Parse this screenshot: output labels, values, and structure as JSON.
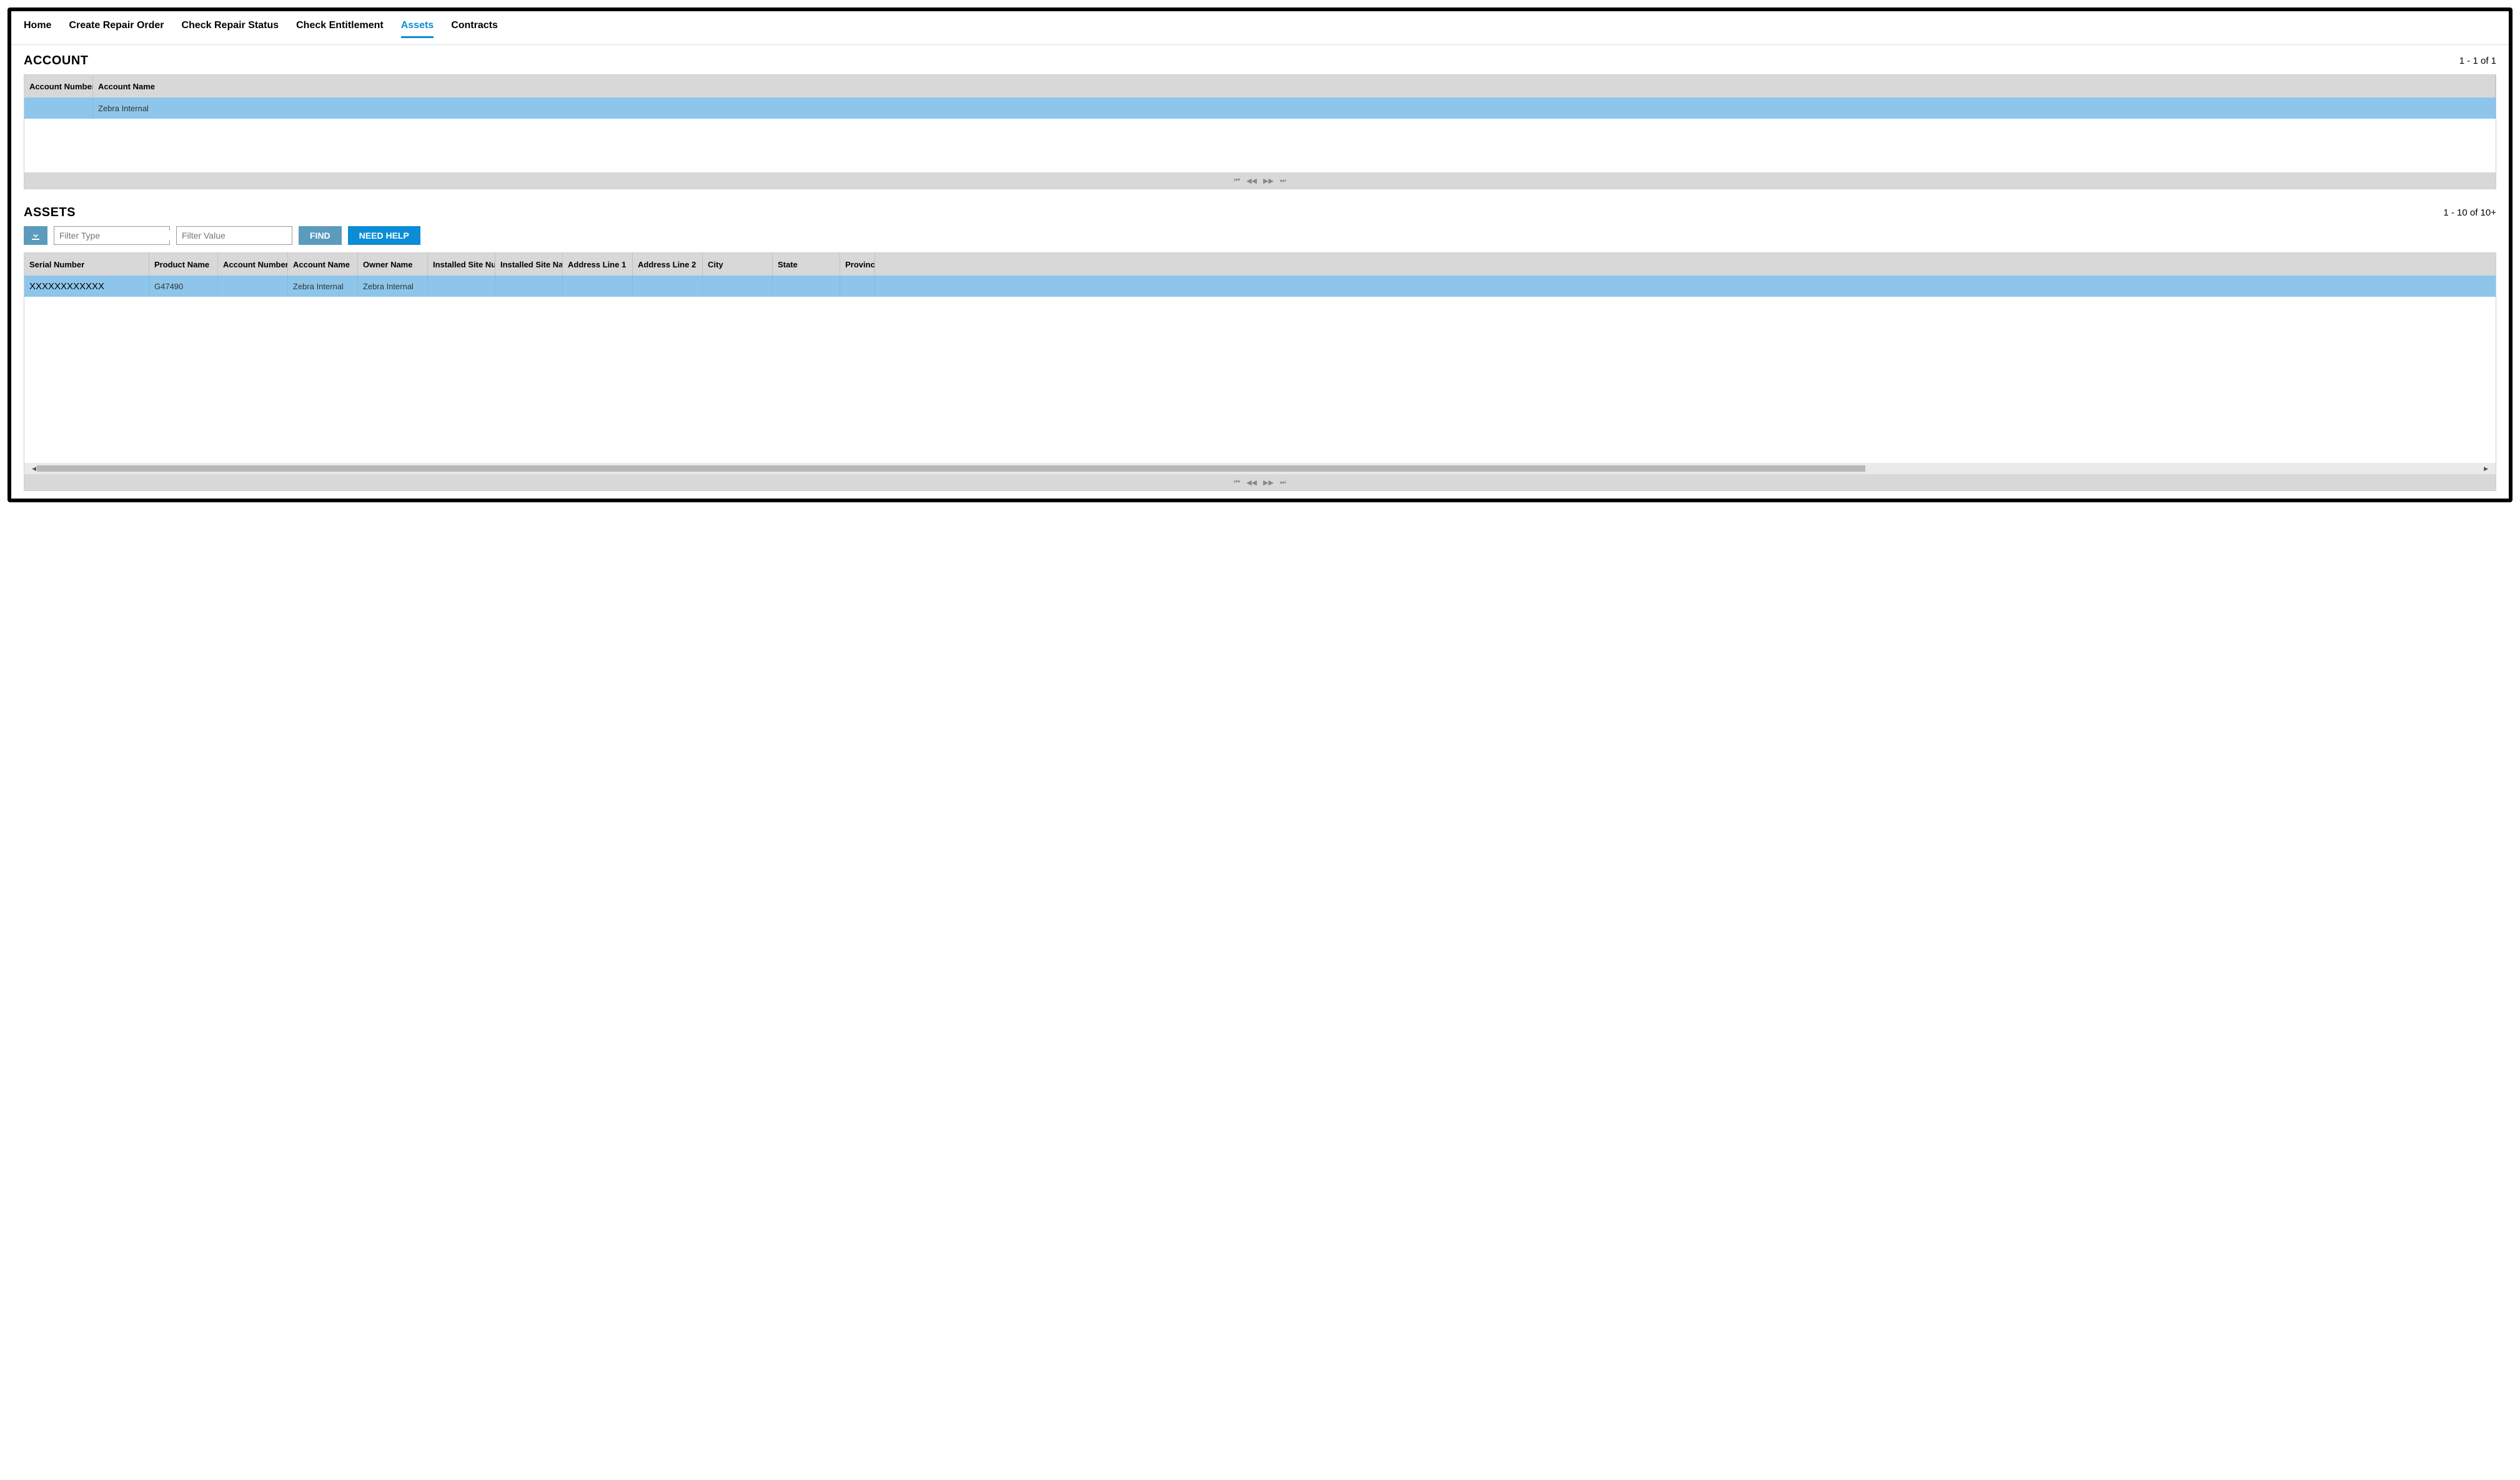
{
  "nav": {
    "tabs": [
      {
        "label": "Home",
        "active": false
      },
      {
        "label": "Create Repair Order",
        "active": false
      },
      {
        "label": "Check Repair Status",
        "active": false
      },
      {
        "label": "Check Entitlement",
        "active": false
      },
      {
        "label": "Assets",
        "active": true
      },
      {
        "label": "Contracts",
        "active": false
      }
    ]
  },
  "account": {
    "title": "ACCOUNT",
    "counter": "1 - 1 of 1",
    "columns": [
      "Account Number",
      "Account Name"
    ],
    "rows": [
      {
        "account_number": "",
        "account_name": "Zebra Internal",
        "selected": true
      }
    ]
  },
  "assets": {
    "title": "ASSETS",
    "counter": "1 - 10 of 10+",
    "toolbar": {
      "download_icon": "download-icon",
      "filter_type_placeholder": "Filter Type",
      "filter_value_placeholder": "Filter Value",
      "find_label": "FIND",
      "help_label": "NEED HELP"
    },
    "columns": [
      "Serial Number",
      "Product Name",
      "Account Number",
      "Account Name",
      "Owner Name",
      "Installed Site Numb",
      "Installed Site Name",
      "Address Line 1",
      "Address Line 2",
      "City",
      "State",
      "Province"
    ],
    "rows": [
      {
        "serial_number": "XXXXXXXXXXXX",
        "product_name": "G47490",
        "account_number": "",
        "account_name": "Zebra Internal",
        "owner_name": "Zebra Internal",
        "installed_site_numb": "",
        "installed_site_name": "",
        "address_line_1": "",
        "address_line_2": "",
        "city": "",
        "state": "",
        "province": "",
        "selected": true
      }
    ]
  },
  "pager_icons": {
    "first": "⏮",
    "prev": "◀◀",
    "next": "▶▶",
    "last": "⏭"
  }
}
